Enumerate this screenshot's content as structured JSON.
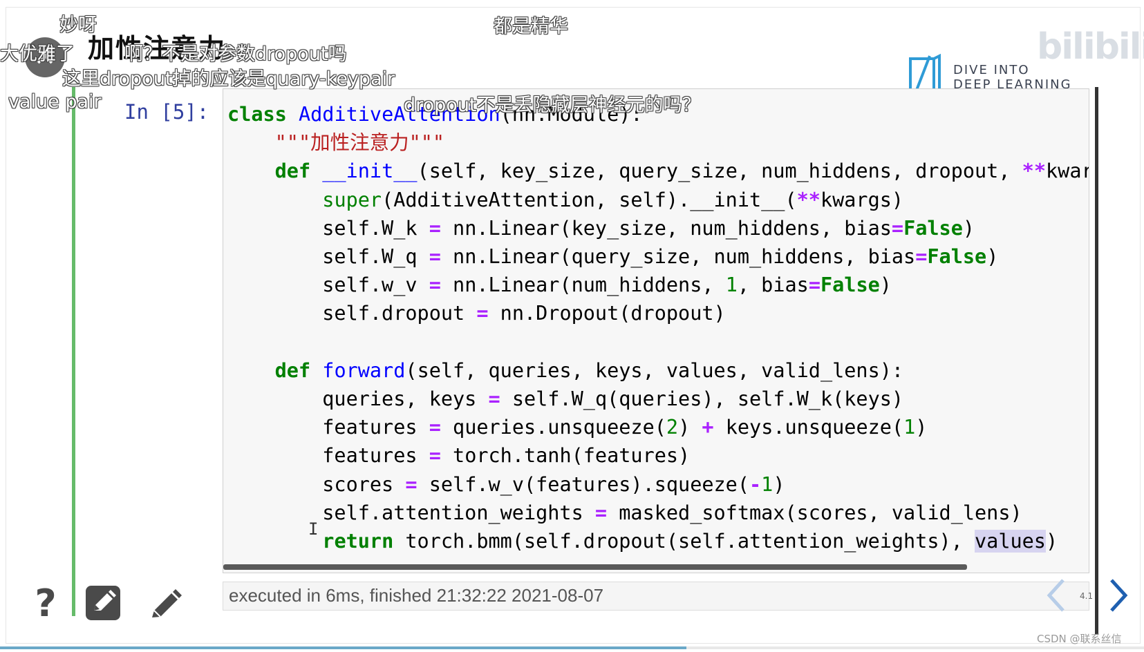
{
  "slide": {
    "title": "加性注意力"
  },
  "logo": {
    "line1": "DIVE INTO",
    "line2": "DEEP LEARNING"
  },
  "watermark": "bilibili",
  "cell": {
    "prompt": "In [5]:"
  },
  "execution": {
    "text": "executed in 6ms, finished 21:32:22 2021-08-07"
  },
  "pager": {
    "page": "4.1"
  },
  "credit": "CSDN @联系丝信",
  "danmaku": [
    "妙呀",
    "大优雅了",
    "啊？不是对参数dropout吗",
    "这里dropout掉的应该是quary-keypair",
    "value pair",
    "都是精华",
    "dropout不是丢隐藏层神经元的吗？"
  ],
  "colors": {
    "cell_bar": "#66bb6a",
    "keyword": "#008000",
    "function": "#0000ff",
    "string": "#ba2121",
    "operator": "#aa22ff",
    "prompt": "#303f9f"
  },
  "icons": [
    "help-icon",
    "edit-cell-icon",
    "pencil-icon",
    "chevron-left-icon",
    "chevron-right-icon",
    "close-icon",
    "d2l-logo-icon"
  ]
}
